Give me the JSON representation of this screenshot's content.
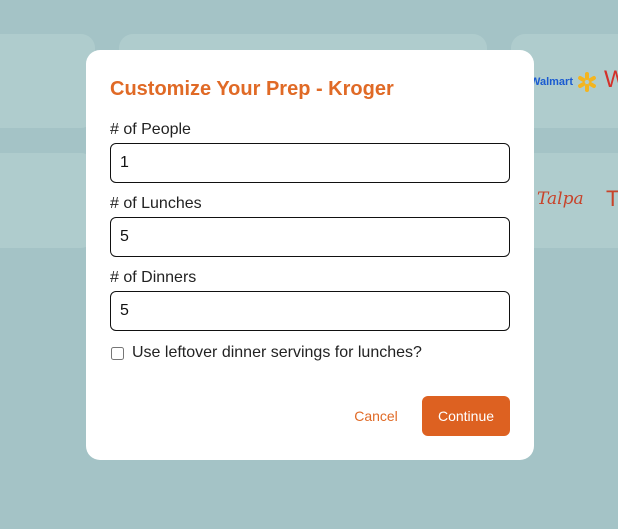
{
  "background": {
    "logos": {
      "walmart": "Walmart",
      "walmart_partial": "W",
      "talpa": "Talpa",
      "talpa_partial": "T"
    }
  },
  "modal": {
    "title": "Customize Your Prep - Kroger",
    "fields": [
      {
        "label": "# of People",
        "value": "1"
      },
      {
        "label": "# of Lunches",
        "value": "5"
      },
      {
        "label": "# of Dinners",
        "value": "5"
      }
    ],
    "leftover_checkbox": {
      "label": "Use leftover dinner servings for lunches?",
      "checked": false
    },
    "cancel_label": "Cancel",
    "continue_label": "Continue"
  },
  "colors": {
    "accent": "#e06a26",
    "primary_button": "#dd6121",
    "backdrop": "#a4c3c6"
  }
}
